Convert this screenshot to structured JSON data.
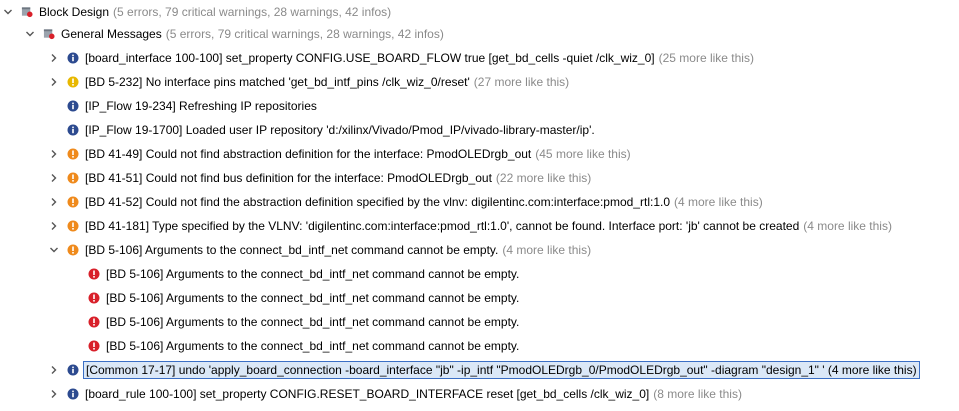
{
  "tree": {
    "root": {
      "label": "Block Design",
      "counts": "(5 errors, 79 critical warnings, 28 warnings, 42 infos)"
    },
    "group": {
      "label": "General Messages",
      "counts": "(5 errors, 79 critical warnings, 28 warnings, 42 infos)"
    },
    "messages": [
      {
        "text": "[board_interface 100-100] set_property CONFIG.USE_BOARD_FLOW true [get_bd_cells -quiet /clk_wiz_0]",
        "more": "(25 more like this)",
        "severity": "info"
      },
      {
        "text": "[BD 5-232] No interface pins matched 'get_bd_intf_pins /clk_wiz_0/reset'",
        "more": "(27 more like this)",
        "severity": "warning"
      },
      {
        "text": "[IP_Flow 19-234] Refreshing IP repositories",
        "more": "",
        "severity": "info"
      },
      {
        "text": "[IP_Flow 19-1700] Loaded user IP repository 'd:/xilinx/Vivado/Pmod_IP/vivado-library-master/ip'.",
        "more": "",
        "severity": "info"
      },
      {
        "text": "[BD 41-49] Could not find abstraction definition for the interface: PmodOLEDrgb_out",
        "more": "(45 more like this)",
        "severity": "critical-warning"
      },
      {
        "text": "[BD 41-51] Could not find bus definition for the interface: PmodOLEDrgb_out",
        "more": "(22 more like this)",
        "severity": "critical-warning"
      },
      {
        "text": "[BD 41-52] Could not find the abstraction definition specified by the vlnv: digilentinc.com:interface:pmod_rtl:1.0",
        "more": "(4 more like this)",
        "severity": "critical-warning"
      },
      {
        "text": "[BD 41-181] Type specified by the VLNV: 'digilentinc.com:interface:pmod_rtl:1.0', cannot be found. Interface port: 'jb' cannot be created",
        "more": "(4 more like this)",
        "severity": "critical-warning"
      },
      {
        "text": "[BD 5-106] Arguments to the connect_bd_intf_net command cannot be empty.",
        "more": "(4 more like this)",
        "severity": "error"
      },
      {
        "text": "[BD 5-106] Arguments to the connect_bd_intf_net command cannot be empty.",
        "more": "",
        "severity": "error"
      },
      {
        "text": "[BD 5-106] Arguments to the connect_bd_intf_net command cannot be empty.",
        "more": "",
        "severity": "error"
      },
      {
        "text": "[BD 5-106] Arguments to the connect_bd_intf_net command cannot be empty.",
        "more": "",
        "severity": "error"
      },
      {
        "text": "[BD 5-106] Arguments to the connect_bd_intf_net command cannot be empty.",
        "more": "",
        "severity": "error"
      },
      {
        "text": "[Common 17-17] undo 'apply_board_connection -board_interface \"jb\" -ip_intf \"PmodOLEDrgb_0/PmodOLEDrgb_out\" -diagram \"design_1\" '",
        "more": "(4 more like this)",
        "severity": "info"
      },
      {
        "text": "[board_rule 100-100] set_property CONFIG.RESET_BOARD_INTERFACE reset [get_bd_cells /clk_wiz_0]",
        "more": "(8 more like this)",
        "severity": "info"
      }
    ]
  },
  "colors": {
    "info": "#2c4a8f",
    "warning": "#e8b800",
    "critical": "#ef8a1c",
    "error": "#d8202a",
    "selection": "#dbe8f7",
    "muted": "#8a8a8a"
  }
}
